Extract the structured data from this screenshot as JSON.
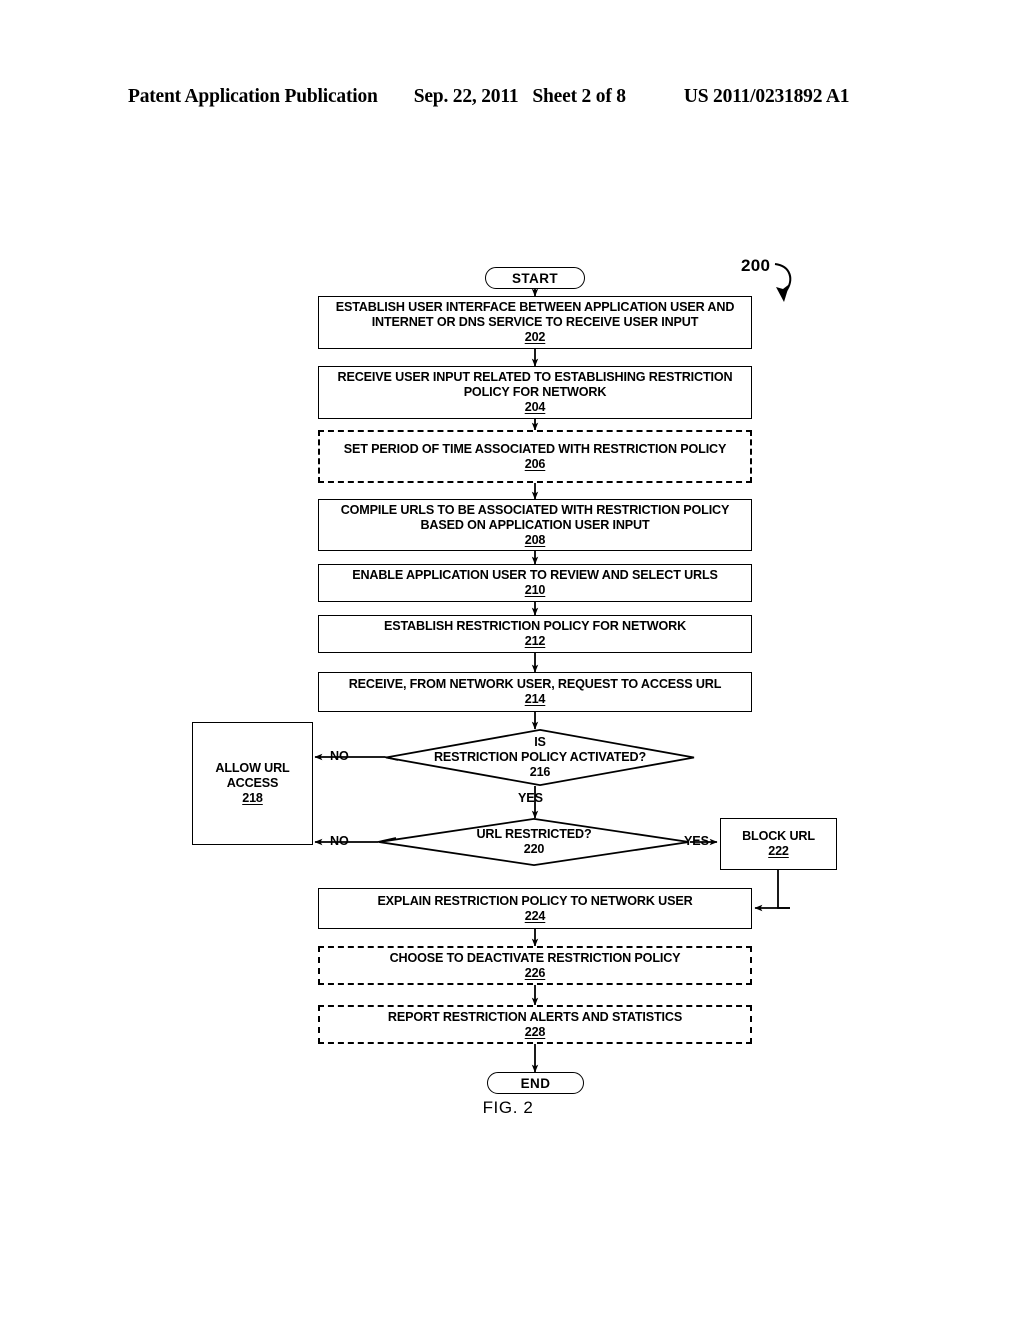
{
  "header": {
    "publication": "Patent Application Publication",
    "date": "Sep. 22, 2011",
    "sheet": "Sheet 2 of 8",
    "patent_number": "US 2011/0231892 A1"
  },
  "figure": {
    "caption": "FIG. 2",
    "callout_ref": "200"
  },
  "flowchart": {
    "start_label": "START",
    "end_label": "END",
    "nodes": [
      {
        "id": "202",
        "ref": "202",
        "text": "ESTABLISH USER INTERFACE BETWEEN APPLICATION USER AND INTERNET OR DNS SERVICE TO RECEIVE USER INPUT",
        "style": "solid"
      },
      {
        "id": "204",
        "ref": "204",
        "text": "RECEIVE USER INPUT RELATED TO ESTABLISHING RESTRICTION POLICY FOR NETWORK",
        "style": "solid"
      },
      {
        "id": "206",
        "ref": "206",
        "text": "SET PERIOD OF TIME ASSOCIATED WITH RESTRICTION POLICY",
        "style": "dashed"
      },
      {
        "id": "208",
        "ref": "208",
        "text": "COMPILE URLS TO BE ASSOCIATED WITH RESTRICTION POLICY BASED ON APPLICATION USER INPUT",
        "style": "solid"
      },
      {
        "id": "210",
        "ref": "210",
        "text": "ENABLE APPLICATION USER TO REVIEW AND SELECT URLS",
        "style": "solid"
      },
      {
        "id": "212",
        "ref": "212",
        "text": "ESTABLISH RESTRICTION POLICY FOR NETWORK",
        "style": "solid"
      },
      {
        "id": "214",
        "ref": "214",
        "text": "RECEIVE, FROM NETWORK USER, REQUEST TO ACCESS URL",
        "style": "solid"
      },
      {
        "id": "216",
        "ref": "216",
        "text": "IS RESTRICTION POLICY ACTIVATED?",
        "text_line1": "IS",
        "text_line2": "RESTRICTION POLICY ACTIVATED?",
        "style": "decision"
      },
      {
        "id": "218",
        "ref": "218",
        "text": "ALLOW URL ACCESS",
        "text_line1": "ALLOW URL",
        "text_line2": "ACCESS",
        "style": "solid"
      },
      {
        "id": "220",
        "ref": "220",
        "text": "URL RESTRICTED?",
        "style": "decision"
      },
      {
        "id": "222",
        "ref": "222",
        "text": "BLOCK URL",
        "style": "solid"
      },
      {
        "id": "224",
        "ref": "224",
        "text": "EXPLAIN RESTRICTION POLICY TO NETWORK USER",
        "style": "solid"
      },
      {
        "id": "226",
        "ref": "226",
        "text": "CHOOSE TO DEACTIVATE RESTRICTION POLICY",
        "style": "dashed"
      },
      {
        "id": "228",
        "ref": "228",
        "text": "REPORT RESTRICTION ALERTS AND STATISTICS",
        "style": "dashed"
      }
    ],
    "edge_labels": {
      "no_216": "NO",
      "yes_216": "YES",
      "no_220": "NO",
      "yes_220": "YES"
    }
  }
}
